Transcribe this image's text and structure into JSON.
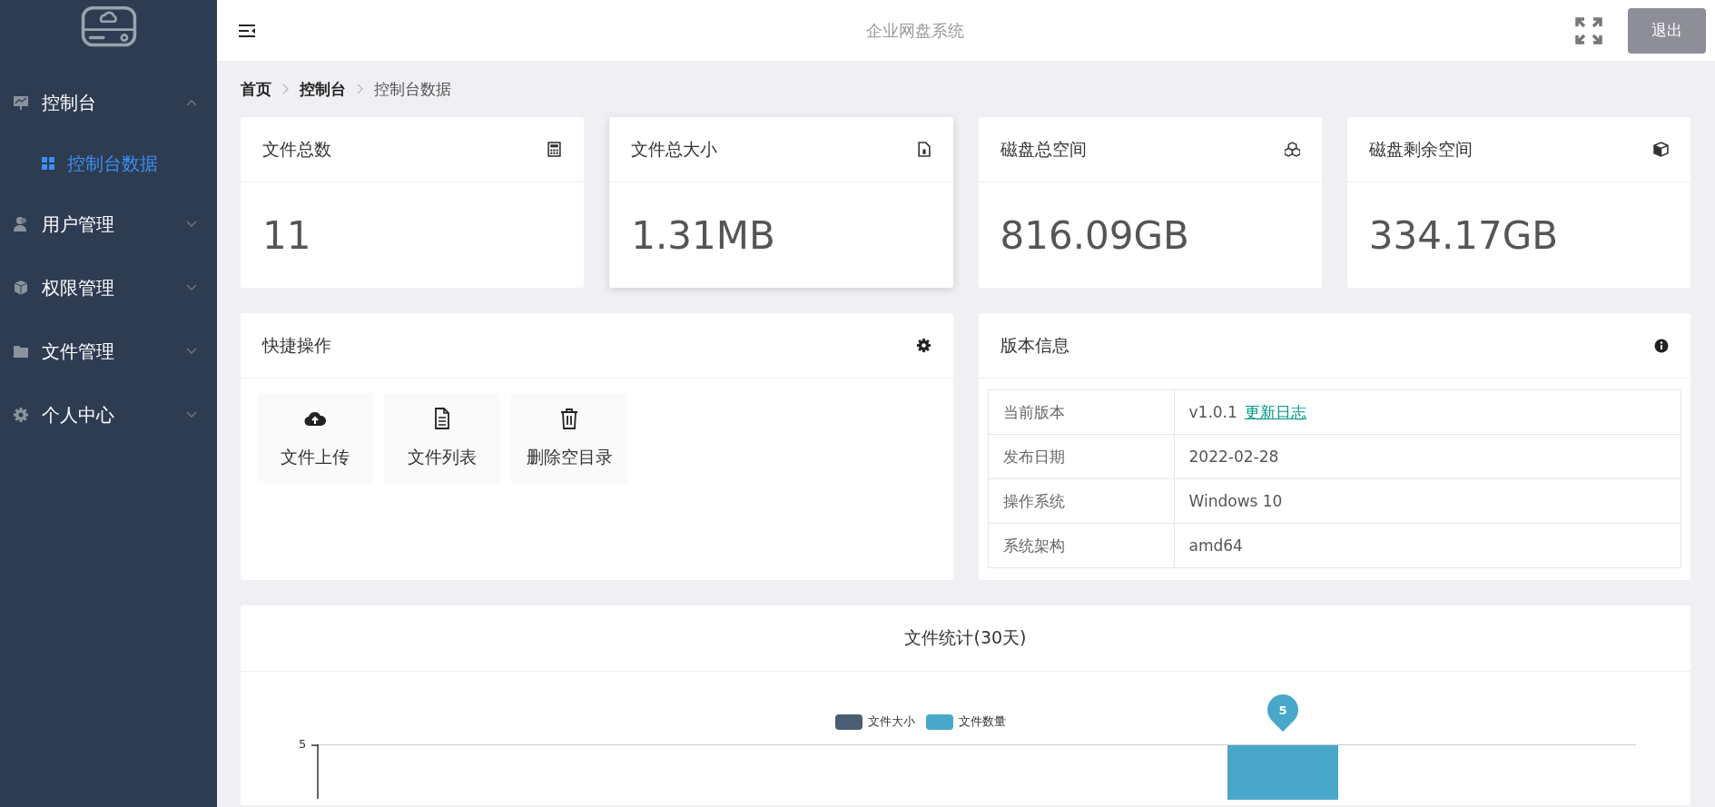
{
  "header": {
    "title": "企业网盘系统",
    "logout_button": "退出"
  },
  "sidebar": {
    "items": [
      {
        "label": "控制台",
        "expanded": true,
        "children": [
          {
            "label": "控制台数据",
            "selected": true
          }
        ]
      },
      {
        "label": "用户管理",
        "expanded": false
      },
      {
        "label": "权限管理",
        "expanded": false
      },
      {
        "label": "文件管理",
        "expanded": false
      },
      {
        "label": "个人中心",
        "expanded": false
      }
    ]
  },
  "breadcrumb": [
    "首页",
    "控制台",
    "控制台数据"
  ],
  "stat_cards": [
    {
      "title": "文件总数",
      "value": "11",
      "raised": false
    },
    {
      "title": "文件总大小",
      "value": "1.31MB",
      "raised": true
    },
    {
      "title": "磁盘总空间",
      "value": "816.09GB",
      "raised": false
    },
    {
      "title": "磁盘剩余空间",
      "value": "334.17GB",
      "raised": false
    }
  ],
  "quick_actions": {
    "title": "快捷操作",
    "actions": [
      "文件上传",
      "文件列表",
      "删除空目录"
    ]
  },
  "version_info": {
    "title": "版本信息",
    "rows": [
      {
        "label": "当前版本",
        "value": "v1.0.1",
        "link": "更新日志"
      },
      {
        "label": "发布日期",
        "value": "2022-02-28"
      },
      {
        "label": "操作系统",
        "value": "Windows 10"
      },
      {
        "label": "系统架构",
        "value": "amd64"
      }
    ]
  },
  "file_stats": {
    "title": "文件统计(30天)",
    "legend": [
      {
        "name": "文件大小",
        "color": "#4a5e74"
      },
      {
        "name": "文件数量",
        "color": "#49a8c9"
      }
    ],
    "y_tick_label": "5",
    "bar_label": "5"
  }
}
